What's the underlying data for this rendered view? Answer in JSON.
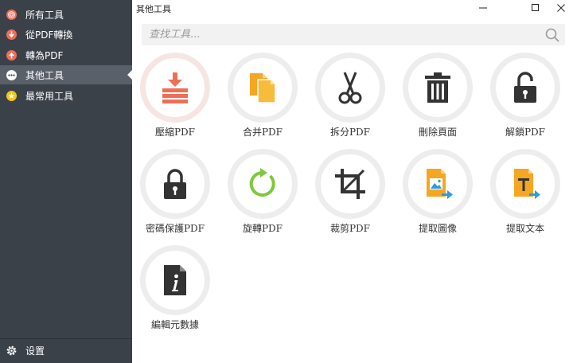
{
  "sidebar": {
    "items": [
      {
        "label": "所有工具",
        "icon": "all-tools-icon",
        "color": "#ee6f57"
      },
      {
        "label": "從PDF轉換",
        "icon": "convert-from-icon",
        "color": "#ee6f57"
      },
      {
        "label": "轉為PDF",
        "icon": "convert-to-icon",
        "color": "#ee6f57"
      },
      {
        "label": "其他工具",
        "icon": "more-icon",
        "color": "#ffffff",
        "active": true
      },
      {
        "label": "最常用工具",
        "icon": "star-icon",
        "color": "#f5c518"
      }
    ],
    "settings_label": "设置"
  },
  "header": {
    "title": "其他工具"
  },
  "window": {
    "minimize": "—",
    "maximize": "☐",
    "close": "✕"
  },
  "search": {
    "placeholder": "查找工具...",
    "value": ""
  },
  "colors": {
    "sidebar_bg": "#3b4149",
    "active_bg": "#5a6069",
    "accent_red": "#ee6f57",
    "accent_orange": "#f5a623",
    "accent_green": "#7dc93b",
    "accent_blue": "#2d9cdb",
    "icon_dark": "#333333"
  },
  "tools": [
    {
      "label": "壓縮PDF",
      "icon": "compress-icon"
    },
    {
      "label": "合并PDF",
      "icon": "merge-icon"
    },
    {
      "label": "拆分PDF",
      "icon": "scissors-icon"
    },
    {
      "label": "刪除頁面",
      "icon": "trash-icon"
    },
    {
      "label": "解鎖PDF",
      "icon": "unlock-icon"
    },
    {
      "label": "密碼保護PDF",
      "icon": "lock-icon"
    },
    {
      "label": "旋轉PDF",
      "icon": "rotate-icon"
    },
    {
      "label": "裁剪PDF",
      "icon": "crop-icon"
    },
    {
      "label": "提取圖像",
      "icon": "extract-image-icon"
    },
    {
      "label": "提取文本",
      "icon": "extract-text-icon"
    },
    {
      "label": "編輯元數據",
      "icon": "metadata-icon"
    }
  ]
}
